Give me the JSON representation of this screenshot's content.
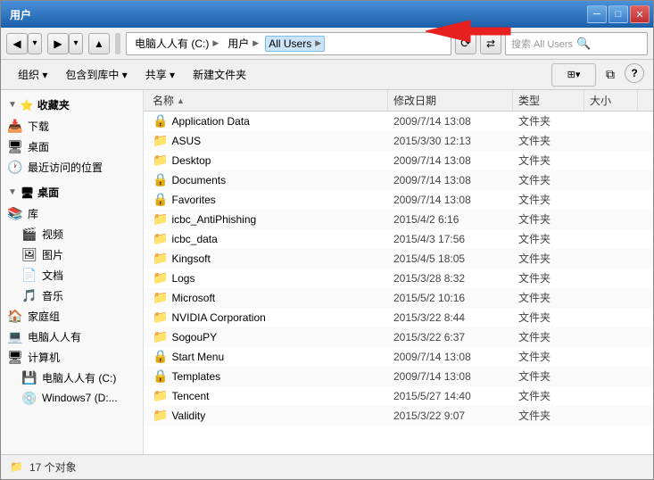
{
  "window": {
    "title": "用户",
    "controls": {
      "minimize": "─",
      "maximize": "□",
      "close": "✕"
    }
  },
  "address_bar": {
    "breadcrumbs": [
      {
        "label": "电脑人人有 (C:)",
        "active": false
      },
      {
        "label": "用户",
        "active": false
      },
      {
        "label": "All Users",
        "active": true
      }
    ],
    "search_placeholder": "搜索 All Users",
    "refresh_icon": "⟳"
  },
  "toolbar": {
    "organize": "组织 ▾",
    "library": "包含到库中 ▾",
    "share": "共享 ▾",
    "new_folder": "新建文件夹"
  },
  "sidebar": {
    "favorites_header": "收藏夹",
    "favorites": [
      {
        "label": "下载",
        "icon": "📥"
      },
      {
        "label": "桌面",
        "icon": "🖥"
      },
      {
        "label": "最近访问的位置",
        "icon": "🕐"
      }
    ],
    "desktop_header": "桌面",
    "libraries": [
      {
        "label": "库",
        "icon": "📚"
      },
      {
        "label": "视频",
        "icon": "🎬"
      },
      {
        "label": "图片",
        "icon": "🖼"
      },
      {
        "label": "文档",
        "icon": "📄"
      },
      {
        "label": "音乐",
        "icon": "🎵"
      }
    ],
    "homegroup": {
      "label": "家庭组",
      "icon": "🏠"
    },
    "computer": {
      "label": "电脑人人有",
      "icon": "💻"
    },
    "my_computer": {
      "label": "计算机",
      "icon": "🖥"
    },
    "drives": [
      {
        "label": "电脑人人有 (C:)",
        "icon": "💾"
      },
      {
        "label": "Windows7 (D:...",
        "icon": "💿"
      }
    ]
  },
  "file_list": {
    "columns": {
      "name": "名称",
      "date": "修改日期",
      "type": "类型",
      "size": "大小"
    },
    "files": [
      {
        "name": "Application Data",
        "date": "2009/7/14 13:08",
        "type": "文件夹",
        "size": "",
        "special": true
      },
      {
        "name": "ASUS",
        "date": "2015/3/30 12:13",
        "type": "文件夹",
        "size": "",
        "special": false
      },
      {
        "name": "Desktop",
        "date": "2009/7/14 13:08",
        "type": "文件夹",
        "size": "",
        "special": false
      },
      {
        "name": "Documents",
        "date": "2009/7/14 13:08",
        "type": "文件夹",
        "size": "",
        "special": true
      },
      {
        "name": "Favorites",
        "date": "2009/7/14 13:08",
        "type": "文件夹",
        "size": "",
        "special": true
      },
      {
        "name": "icbc_AntiPhishing",
        "date": "2015/4/2 6:16",
        "type": "文件夹",
        "size": "",
        "special": false
      },
      {
        "name": "icbc_data",
        "date": "2015/4/3 17:56",
        "type": "文件夹",
        "size": "",
        "special": false
      },
      {
        "name": "Kingsoft",
        "date": "2015/4/5 18:05",
        "type": "文件夹",
        "size": "",
        "special": false
      },
      {
        "name": "Logs",
        "date": "2015/3/28 8:32",
        "type": "文件夹",
        "size": "",
        "special": false
      },
      {
        "name": "Microsoft",
        "date": "2015/5/2 10:16",
        "type": "文件夹",
        "size": "",
        "special": false
      },
      {
        "name": "NVIDIA Corporation",
        "date": "2015/3/22 8:44",
        "type": "文件夹",
        "size": "",
        "special": false
      },
      {
        "name": "SogouPY",
        "date": "2015/3/22 6:37",
        "type": "文件夹",
        "size": "",
        "special": false
      },
      {
        "name": "Start Menu",
        "date": "2009/7/14 13:08",
        "type": "文件夹",
        "size": "",
        "special": true
      },
      {
        "name": "Templates",
        "date": "2009/7/14 13:08",
        "type": "文件夹",
        "size": "",
        "special": true
      },
      {
        "name": "Tencent",
        "date": "2015/5/27 14:40",
        "type": "文件夹",
        "size": "",
        "special": false
      },
      {
        "name": "Validity",
        "date": "2015/3/22 9:07",
        "type": "文件夹",
        "size": "",
        "special": false
      }
    ]
  },
  "status_bar": {
    "text": "17 个对象"
  },
  "annotation": {
    "all_users_label": "All Users"
  }
}
